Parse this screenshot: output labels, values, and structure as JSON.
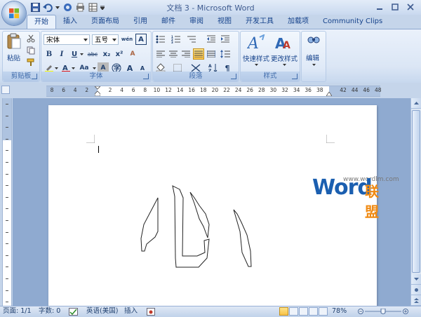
{
  "window": {
    "title": "文档 3 - Microsoft Word"
  },
  "tabs": [
    {
      "label": "开始",
      "active": true
    },
    {
      "label": "插入",
      "active": false
    },
    {
      "label": "页面布局",
      "active": false
    },
    {
      "label": "引用",
      "active": false
    },
    {
      "label": "邮件",
      "active": false
    },
    {
      "label": "审阅",
      "active": false
    },
    {
      "label": "视图",
      "active": false
    },
    {
      "label": "开发工具",
      "active": false
    },
    {
      "label": "加载项",
      "active": false
    },
    {
      "label": "Community Clips",
      "active": false
    }
  ],
  "ribbon": {
    "clipboard": {
      "paste_label": "粘贴",
      "group_label": "剪贴板"
    },
    "font": {
      "font_name": "宋体",
      "font_size": "五号",
      "group_label": "字体",
      "wen_glyph": "wén",
      "btn_bold": "B",
      "btn_italic": "I",
      "btn_underline": "U",
      "btn_strike": "abc",
      "btn_sub": "x₂",
      "btn_sup": "x²",
      "btn_case": "Aa",
      "btn_grow": "A",
      "btn_shrink": "A",
      "btn_clear": "A",
      "btn_border": "A"
    },
    "paragraph": {
      "group_label": "段落"
    },
    "styles": {
      "quick_styles": "快速样式",
      "change_styles": "更改样式",
      "group_label": "样式"
    },
    "editing": {
      "label": "编辑"
    }
  },
  "ruler": {
    "numbers": [
      "8",
      "6",
      "4",
      "2",
      "",
      "2",
      "4",
      "6",
      "8",
      "10",
      "12",
      "14",
      "16",
      "18",
      "20",
      "22",
      "24",
      "26",
      "28",
      "30",
      "32",
      "34",
      "36",
      "38",
      "",
      "42",
      "44",
      "46",
      "48"
    ]
  },
  "document": {
    "watermark_url": "www.wordlm.com",
    "watermark_logo": "Word",
    "watermark_cn": "联盟"
  },
  "statusbar": {
    "page": "页面: 1/1",
    "words": "字数: 0",
    "language": "英语(美国)",
    "mode": "插入",
    "zoom": "78%"
  },
  "colors": {
    "accent": "#15428b",
    "watermark_blue": "#1b5fb0",
    "watermark_orange": "#f08a12"
  }
}
